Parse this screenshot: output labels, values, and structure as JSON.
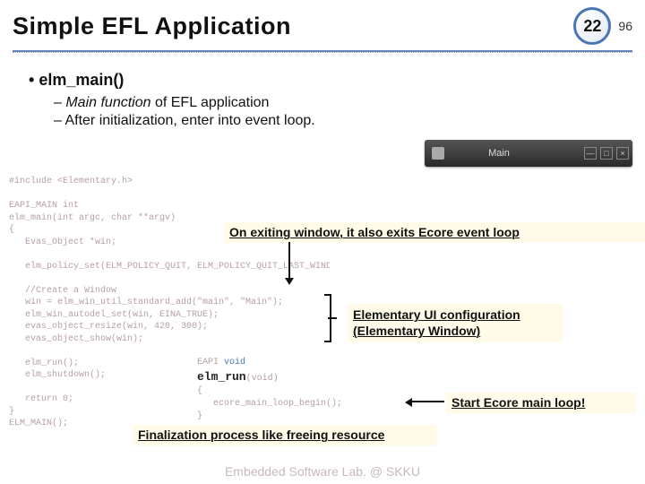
{
  "header": {
    "title": "Simple EFL Application",
    "slide_no": "22",
    "total": "96"
  },
  "bullets": {
    "l1": "elm_main()",
    "l2a_ital": "Main function",
    "l2a_rest": " of EFL application",
    "l2b": "After initialization, enter into event loop."
  },
  "annotations": {
    "a1": "On exiting window, it also exits Ecore event loop",
    "a2_line1": "Elementary UI configuration",
    "a2_line2": "(Elementary Window)",
    "a3": "Start Ecore main loop!",
    "a4": "Finalization process like freeing resource"
  },
  "code1_lines": [
    "#include <Elementary.h>",
    "",
    "EAPI_MAIN int",
    "elm_main(int argc, char **argv)",
    "{",
    "   Evas_Object *win;",
    "",
    "   elm_policy_set(ELM_POLICY_QUIT, ELM_POLICY_QUIT_LAST_WINDOW_CLOSED);",
    "",
    "   //Create a Window",
    "   win = elm_win_util_standard_add(\"main\", \"Main\");",
    "   elm_win_autodel_set(win, EINA_TRUE);",
    "   evas_object_resize(win, 420, 300);",
    "   evas_object_show(win);",
    "",
    "   elm_run();",
    "   elm_shutdown();",
    "",
    "   return 0;",
    "}",
    "ELM_MAIN();"
  ],
  "code2": {
    "sig_prefix": "EAPI ",
    "sig_kw": "void",
    "big": "elm_run",
    "sig_suffix": "(void)",
    "body1": "{",
    "body2": "   ecore_main_loop_begin();",
    "body3": "}"
  },
  "win": {
    "title": "Main"
  },
  "footer": "Embedded Software Lab. @ SKKU"
}
